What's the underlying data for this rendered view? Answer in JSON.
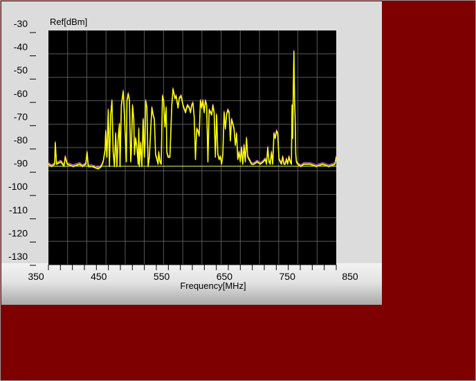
{
  "chart_data": {
    "type": "line",
    "ylabel": "Ref[dBm]",
    "xlabel": "Frequency[MHz]",
    "xlim": [
      350,
      850
    ],
    "ylim": [
      -130,
      -30
    ],
    "y_ticks": [
      -30,
      -40,
      -50,
      -60,
      -70,
      -80,
      -90,
      -100,
      -110,
      -120,
      -130
    ],
    "y_tick_labels": [
      "-30",
      "-40",
      "-50",
      "-60",
      "-70",
      "-80",
      "-90",
      "-100",
      "-110",
      "-120",
      "-130"
    ],
    "x_ticks": [
      350,
      450,
      550,
      650,
      750,
      850
    ],
    "x_tick_labels": [
      "350",
      "450",
      "550",
      "650",
      "750",
      "850"
    ],
    "plot_xlim": [
      370,
      832
    ],
    "plot_ylim": [
      -134,
      -34
    ],
    "grid": true,
    "reference_level": -92,
    "colors": {
      "background": "#000000",
      "grid": "#5a5a5a",
      "trace_current": "#ffff00",
      "trace_max": "#d060d0",
      "trace_avg": "#6fbf3f",
      "reference_line": "#ffff66",
      "panel": "#dcdcdc",
      "outer": "#7e0000"
    },
    "series": [
      {
        "color": "#ffff00",
        "x": [
          370,
          375,
          380,
          381,
          383,
          390,
          395,
          397,
          400,
          410,
          420,
          425,
          430,
          432,
          434,
          440,
          450,
          455,
          458,
          461,
          462,
          464,
          466,
          468,
          470,
          472,
          474,
          476,
          478,
          480,
          482,
          484,
          485,
          487,
          490,
          492,
          495,
          496,
          498,
          500,
          502,
          503,
          505,
          507,
          508,
          510,
          512,
          514,
          515,
          516,
          518,
          520,
          522,
          524,
          525,
          526,
          528,
          530,
          532,
          534,
          536,
          538,
          540,
          542,
          544,
          546,
          547,
          549,
          551,
          553,
          555,
          557,
          559,
          560,
          562,
          565,
          568,
          570,
          573,
          575,
          578,
          580,
          583,
          586,
          590,
          593,
          596,
          598,
          600,
          602,
          604,
          606,
          608,
          610,
          612,
          614,
          616,
          618,
          620,
          622,
          624,
          626,
          628,
          630,
          632,
          634,
          636,
          638,
          640,
          642,
          644,
          646,
          648,
          650,
          652,
          654,
          656,
          658,
          660,
          662,
          664,
          666,
          668,
          670,
          672,
          674,
          676,
          678,
          680,
          682,
          684,
          686,
          688,
          690,
          692,
          694,
          696,
          700,
          705,
          710,
          715,
          718,
          720,
          722,
          724,
          726,
          728,
          730,
          732,
          734,
          736,
          738,
          740,
          742,
          744,
          746,
          748,
          750,
          752,
          754,
          756,
          758,
          760,
          761,
          762,
          763,
          764,
          765,
          766,
          767,
          768,
          770,
          775,
          780,
          790,
          800,
          810,
          820,
          830,
          832
        ],
        "y": [
          -91,
          -92,
          -91,
          -82,
          -91,
          -90,
          -92,
          -88,
          -91,
          -92,
          -91,
          -92,
          -91,
          -86,
          -92,
          -92,
          -93,
          -92,
          -90,
          -85,
          -77,
          -88,
          -68,
          -92,
          -70,
          -64,
          -86,
          -92,
          -78,
          -92,
          -80,
          -74,
          -92,
          -66,
          -60,
          -71,
          -90,
          -64,
          -61,
          -64,
          -90,
          -86,
          -66,
          -72,
          -87,
          -80,
          -84,
          -91,
          -76,
          -92,
          -82,
          -92,
          -72,
          -88,
          -82,
          -64,
          -67,
          -92,
          -88,
          -77,
          -67,
          -70,
          -72,
          -87,
          -89,
          -91,
          -86,
          -90,
          -91,
          -62,
          -64,
          -75,
          -67,
          -86,
          -88,
          -88,
          -66,
          -59,
          -63,
          -62,
          -67,
          -63,
          -62,
          -66,
          -69,
          -66,
          -67,
          -69,
          -66,
          -65,
          -71,
          -89,
          -76,
          -77,
          -79,
          -64,
          -67,
          -64,
          -69,
          -64,
          -66,
          -90,
          -68,
          -69,
          -70,
          -66,
          -69,
          -88,
          -70,
          -87,
          -89,
          -88,
          -91,
          -87,
          -69,
          -76,
          -70,
          -68,
          -69,
          -81,
          -72,
          -74,
          -76,
          -83,
          -78,
          -89,
          -86,
          -90,
          -84,
          -91,
          -83,
          -90,
          -80,
          -88,
          -89,
          -90,
          -91,
          -91,
          -90,
          -91,
          -90,
          -89,
          -91,
          -84,
          -90,
          -91,
          -86,
          -91,
          -78,
          -80,
          -77,
          -78,
          -89,
          -90,
          -91,
          -88,
          -91,
          -91,
          -89,
          -91,
          -88,
          -90,
          -91,
          -66,
          -80,
          -60,
          -43,
          -64,
          -71,
          -87,
          -90,
          -91,
          -92,
          -91,
          -91,
          -92,
          -91,
          -92,
          -91,
          -88
        ]
      }
    ]
  }
}
